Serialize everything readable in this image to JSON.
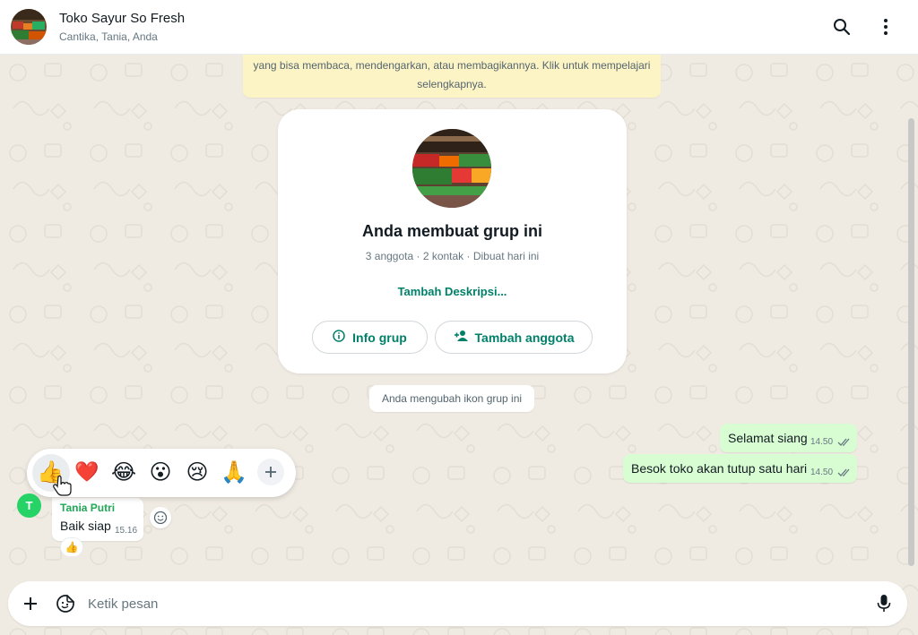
{
  "header": {
    "title": "Toko Sayur So Fresh",
    "members": "Cantika, Tania, Anda",
    "search_icon": "search-icon",
    "menu_icon": "kebab-menu-icon"
  },
  "notice": {
    "line1": "yang bisa membaca, mendengarkan, atau membagikannya. Klik untuk mempelajari",
    "line2": "selengkapnya."
  },
  "group_card": {
    "title": "Anda membuat grup ini",
    "meta": "3 anggota · 2 kontak · Dibuat hari ini",
    "add_description": "Tambah Deskripsi...",
    "info_button": "Info grup",
    "add_member_button": "Tambah anggota"
  },
  "system_message": "Anda mengubah ikon grup ini",
  "outgoing": [
    {
      "text": "Selamat siang",
      "time": "14.50"
    },
    {
      "text": "Besok toko akan tutup satu hari",
      "time": "14.50"
    }
  ],
  "reaction_picker": {
    "emojis": [
      "👍",
      "❤️",
      "😂",
      "😮",
      "😢",
      "🙏"
    ]
  },
  "incoming": {
    "avatar_letter": "T",
    "sender": "Tania Putri",
    "text": "Baik siap",
    "time": "15.16",
    "reaction": "👍"
  },
  "composer": {
    "placeholder": "Ketik pesan"
  },
  "colors": {
    "accent": "#008069",
    "outgoing_bubble": "#d9fdd3",
    "chat_bg": "#efeae2",
    "notice_bg": "#fdf4c5",
    "sender_name": "#1fa855"
  }
}
